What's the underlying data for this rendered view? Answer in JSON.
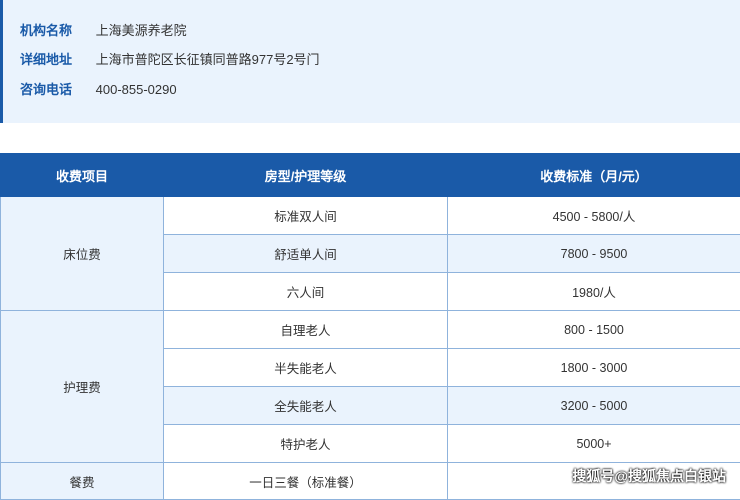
{
  "info": {
    "rows": [
      {
        "label": "机构名称",
        "value": "上海美源养老院"
      },
      {
        "label": "详细地址",
        "value": "上海市普陀区长征镇同普路977号2号门"
      },
      {
        "label": "咨询电话",
        "value": "400-855-0290"
      }
    ]
  },
  "table": {
    "headers": [
      "收费项目",
      "房型/护理等级",
      "收费标准（月/元）"
    ],
    "groups": [
      {
        "category": "床位费",
        "rows": [
          {
            "item": "标准双人间",
            "price": "4500 - 5800/人"
          },
          {
            "item": "舒适单人间",
            "price": "7800 - 9500"
          },
          {
            "item": "六人间",
            "price": "1980/人"
          }
        ]
      },
      {
        "category": "护理费",
        "rows": [
          {
            "item": "自理老人",
            "price": "800 - 1500"
          },
          {
            "item": "半失能老人",
            "price": "1800 - 3000"
          },
          {
            "item": "全失能老人",
            "price": "3200 - 5000"
          },
          {
            "item": "特护老人",
            "price": "5000+"
          }
        ]
      },
      {
        "category": "餐费",
        "rows": [
          {
            "item": "一日三餐（标准餐）",
            "price": ""
          }
        ]
      }
    ]
  },
  "watermark": "搜狐号@搜狐焦点白银站",
  "colors": {
    "accent": "#1a5aa8",
    "light_bg": "#eaf3fd",
    "border": "#8fb3dc"
  }
}
